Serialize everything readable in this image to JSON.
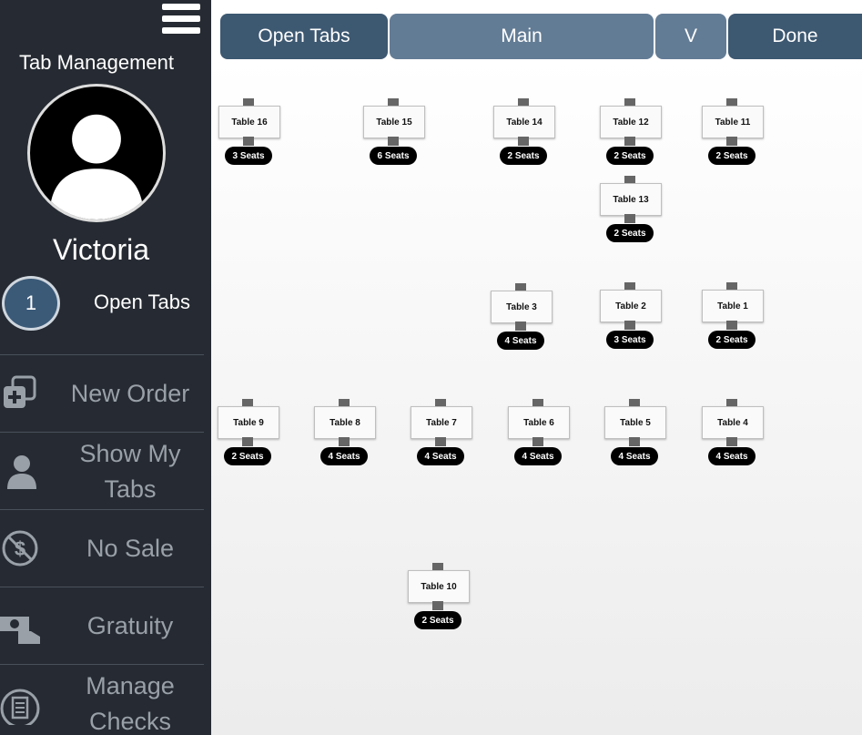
{
  "sidebar": {
    "title": "Tab Management",
    "menu_icon": "hamburger-menu-icon",
    "user": {
      "name": "Victoria",
      "avatar_icon": "user-silhouette-icon"
    },
    "open_tabs": {
      "count": "1",
      "label": "Open Tabs"
    },
    "menu": [
      {
        "label": "New Order",
        "icon": "new-order-icon"
      },
      {
        "label": "Show My Tabs",
        "icon": "person-icon"
      },
      {
        "label": "No Sale",
        "icon": "no-sale-icon"
      },
      {
        "label": "Gratuity",
        "icon": "gratuity-icon"
      },
      {
        "label": "Manage Checks",
        "icon": "checks-icon"
      }
    ]
  },
  "toolbar": {
    "open_tabs": "Open Tabs",
    "main": "Main",
    "v": "V",
    "done": "Done"
  },
  "tables": [
    {
      "name": "Table 16",
      "seats": "3 Seats"
    },
    {
      "name": "Table 15",
      "seats": "6 Seats"
    },
    {
      "name": "Table 14",
      "seats": "2 Seats"
    },
    {
      "name": "Table 12",
      "seats": "2 Seats"
    },
    {
      "name": "Table 11",
      "seats": "2 Seats"
    },
    {
      "name": "Table 13",
      "seats": "2 Seats"
    },
    {
      "name": "Table 3",
      "seats": "4 Seats"
    },
    {
      "name": "Table 2",
      "seats": "3 Seats"
    },
    {
      "name": "Table 1",
      "seats": "2 Seats"
    },
    {
      "name": "Table 9",
      "seats": "2 Seats"
    },
    {
      "name": "Table 8",
      "seats": "4 Seats"
    },
    {
      "name": "Table 7",
      "seats": "4 Seats"
    },
    {
      "name": "Table 6",
      "seats": "4 Seats"
    },
    {
      "name": "Table 5",
      "seats": "4 Seats"
    },
    {
      "name": "Table 4",
      "seats": "4 Seats"
    },
    {
      "name": "Table 10",
      "seats": "2 Seats"
    }
  ],
  "colors": {
    "sidebar_bg": "#262b33",
    "button_dark": "#3d5871",
    "button_light": "#637c95",
    "badge_bg": "#000000"
  }
}
